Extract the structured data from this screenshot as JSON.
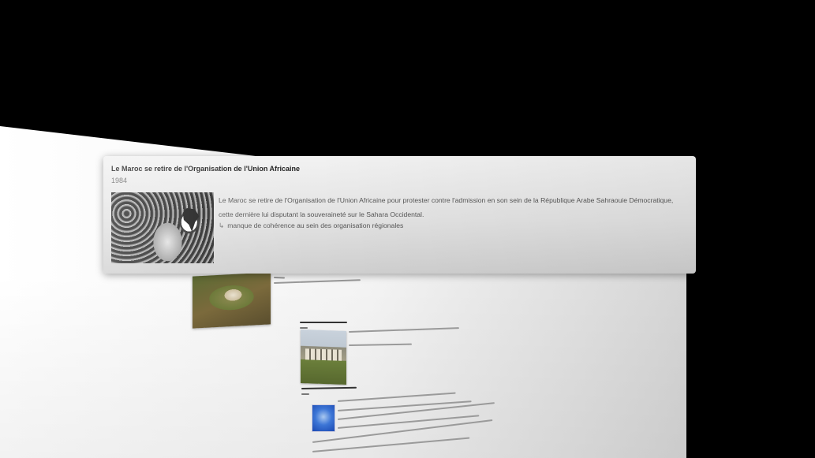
{
  "event": {
    "title": "Le Maroc se retire de l'Organisation de l'Union Africaine",
    "year": "1984",
    "description": "Le Maroc se retire de l'Organisation de l'Union Africaine pour protester contre l'admission en son sein de la République Arabe Sahraouie Démocratique, cette dernière lui disputant la souveraineté sur le Sahara Occidental.",
    "consequence_arrow": "↳",
    "consequence": "manque de cohérence au sein des organisation régionales",
    "image_icon": "oau-poster-illustration"
  },
  "background": {
    "colors": {
      "backdrop": "#000000",
      "page": "#f4f4f4",
      "card": "#e2e2e2"
    },
    "entries": [
      {
        "image_icon": "palace-aerial-photo"
      },
      {
        "image_icon": "university-building-photo"
      },
      {
        "image_icon": "blue-logo"
      }
    ]
  }
}
